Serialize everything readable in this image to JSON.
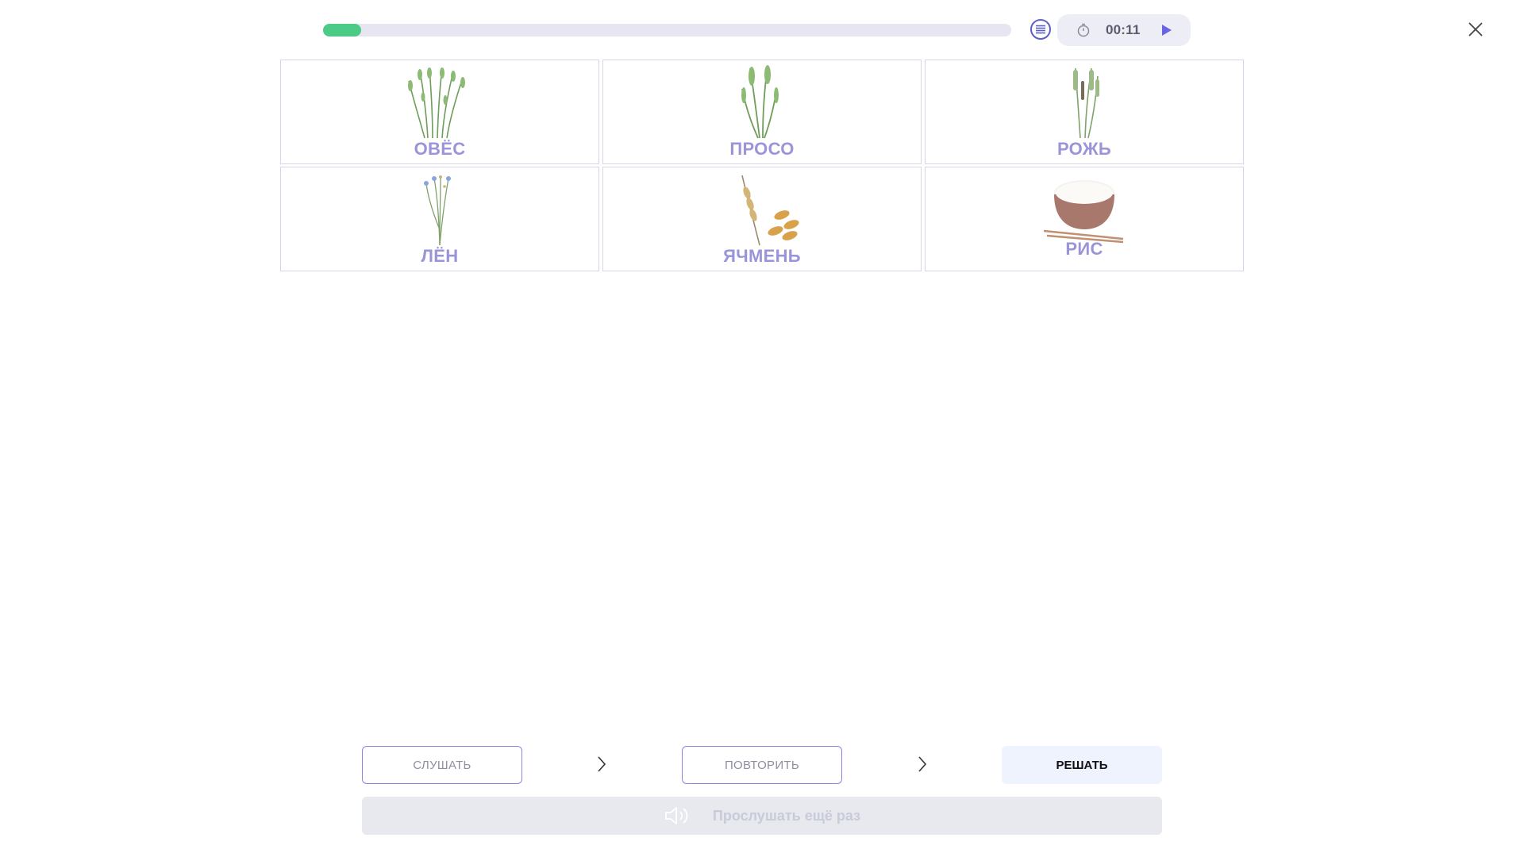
{
  "progress": {
    "value": 0.055,
    "color": "#4ccb86"
  },
  "timer": {
    "time": "00:11"
  },
  "icons": {
    "menu": "list-icon",
    "clock": "stopwatch-icon",
    "play": "play-icon",
    "close": "close-icon",
    "chevron": "chevron-right-icon",
    "speaker": "speaker-icon"
  },
  "cards": [
    {
      "label": "ОВЁС",
      "image": "oats-plant"
    },
    {
      "label": "ПРОСО",
      "image": "millet-plant"
    },
    {
      "label": "РОЖЬ",
      "image": "rye-plant"
    },
    {
      "label": "ЛЁН",
      "image": "flax-plant"
    },
    {
      "label": "ЯЧМЕНЬ",
      "image": "barley-ear-and-grains"
    },
    {
      "label": "РИС",
      "image": "rice-bowl-with-chopsticks"
    }
  ],
  "steps": {
    "listen": "СЛУШАТЬ",
    "repeat": "ПОВТОРИТЬ",
    "solve": "РЕШАТЬ"
  },
  "listen_again": {
    "label": "Прослушать ещё раз"
  },
  "colors": {
    "accent": "#5c5fc8",
    "card_label": "#9a94d9",
    "progress": "#4ccb86"
  }
}
